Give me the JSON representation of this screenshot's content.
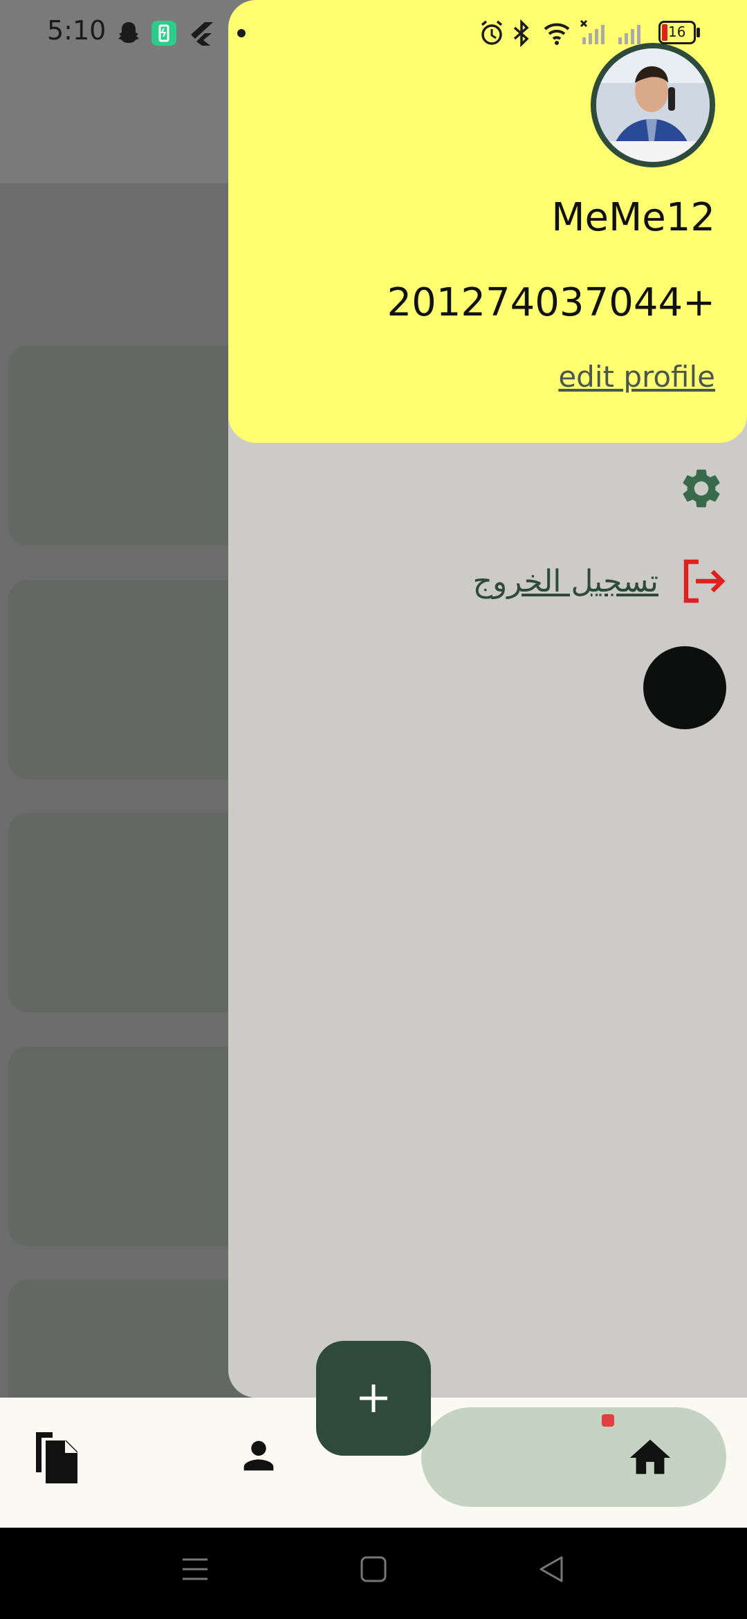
{
  "status_bar": {
    "time": "5:10",
    "battery_level": "16",
    "icons": [
      "snapchat-icon",
      "battery-saver-icon",
      "flutter-icon",
      "notification-dot-icon",
      "alarm-icon",
      "bluetooth-icon",
      "wifi-icon",
      "signal-icon",
      "battery-icon"
    ]
  },
  "drawer": {
    "user_name": "MeMe12",
    "phone": "201274037044+",
    "edit_profile_label": "edit profile",
    "logout_label": "تسجيل الخروج",
    "avatar": "profile-photo",
    "settings_icon": "gear-icon",
    "logout_icon": "logout-icon",
    "theme_icon": "moon-icon"
  },
  "fab": {
    "icon": "plus-icon",
    "label": "+"
  },
  "bottom_nav": {
    "items": [
      {
        "icon": "documents-icon",
        "active": false
      },
      {
        "icon": "person-icon",
        "active": false
      },
      {
        "icon": "home-icon",
        "active": true
      }
    ]
  },
  "colors": {
    "drawer_header": "#ffff71",
    "drawer_body": "#cdcbc8",
    "accent_dark_green": "#2e4a3a",
    "logout_red": "#e02020",
    "nav_active_pill": "#c5d4c2",
    "nav_background": "#fbfaf2"
  },
  "system_nav": {
    "buttons": [
      "menu-icon",
      "home-square-icon",
      "back-triangle-icon"
    ]
  }
}
